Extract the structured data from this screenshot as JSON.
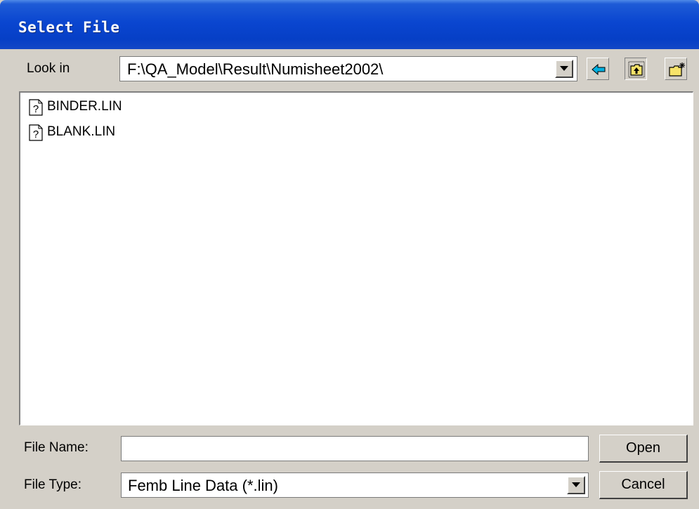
{
  "window": {
    "title": "Select File"
  },
  "lookin": {
    "label": "Look in",
    "path": "F:\\QA_Model\\Result\\Numisheet2002\\"
  },
  "toolbar": {
    "back_icon": "arrow-left-icon",
    "up_icon": "folder-up-icon",
    "new_folder_icon": "new-folder-icon"
  },
  "files": [
    {
      "name": "BINDER.LIN",
      "icon": "unknown-file-icon"
    },
    {
      "name": "BLANK.LIN",
      "icon": "unknown-file-icon"
    }
  ],
  "filename": {
    "label": "File Name:",
    "value": ""
  },
  "filetype": {
    "label": "File Type:",
    "value": "Femb Line Data (*.lin)"
  },
  "buttons": {
    "open": "Open",
    "cancel": "Cancel"
  },
  "colors": {
    "title_bar": "#0a46d0",
    "dialog_face": "#d4d0c8",
    "back_arrow": "#00a0d0"
  }
}
